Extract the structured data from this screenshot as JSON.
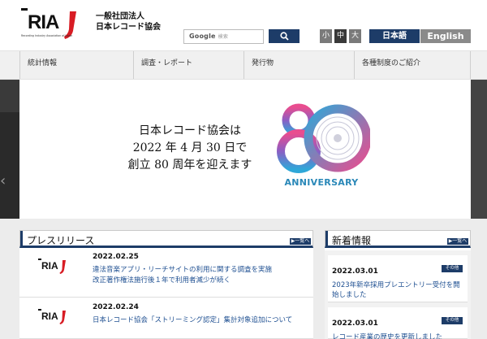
{
  "header": {
    "logo_text": "RIAJ",
    "logo_subtext": "Recording Industry Association of Japan",
    "org_line1": "一般社団法人",
    "org_line2": "日本レコード協会"
  },
  "search": {
    "google_label": "Google",
    "placeholder": "検索",
    "button_icon": "search-icon"
  },
  "font_size": {
    "small": "小",
    "medium": "中",
    "large": "大"
  },
  "language": {
    "japanese": "日本語",
    "english": "English"
  },
  "nav": {
    "items": [
      {
        "label": "統計情報"
      },
      {
        "label": "調査・レポート"
      },
      {
        "label": "発行物"
      },
      {
        "label": "各種制度のご紹介"
      }
    ]
  },
  "hero": {
    "line1": "日本レコード協会は",
    "line2": "2022 年 4 月 30 日で",
    "line3": "創立 80 周年を迎えます",
    "anniversary_number": "80",
    "anniversary_word": "ANNIVERSARY",
    "prev_icon": "chevron-left-icon"
  },
  "press": {
    "title": "プレスリリース",
    "more_label": "▶一覧へ",
    "items": [
      {
        "date": "2022.02.25",
        "line1": "違法音楽アプリ・リーチサイトの利用に関する調査を実施",
        "line2": "改正著作権法施行後１年で利用者減少が続く"
      },
      {
        "date": "2022.02.24",
        "line1": "日本レコード協会「ストリーミング認定」集計対象追加について"
      }
    ]
  },
  "news": {
    "title": "新着情報",
    "more_label": "▶一覧へ",
    "items": [
      {
        "date": "2022.03.01",
        "badge": "その他",
        "line1": "2023年新卒採用プレエントリー受付を開",
        "line2": "始しました"
      },
      {
        "date": "2022.03.01",
        "badge": "その他",
        "line1": "レコード産業の歴史を更新しました"
      }
    ]
  },
  "colors": {
    "navy": "#1d3c68",
    "link": "#1e4f91",
    "logo_red": "#d81c24"
  }
}
